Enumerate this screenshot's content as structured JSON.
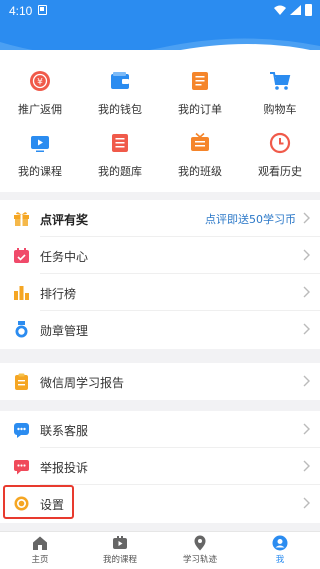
{
  "status_bar": {
    "time": "4:10"
  },
  "grid": [
    {
      "label": "推广返佣",
      "icon": "rebate-icon",
      "color": "#f05a4a"
    },
    {
      "label": "我的钱包",
      "icon": "wallet-icon",
      "color": "#2b8cf0"
    },
    {
      "label": "我的订单",
      "icon": "order-icon",
      "color": "#f5852a"
    },
    {
      "label": "购物车",
      "icon": "cart-icon",
      "color": "#2b8cf0"
    },
    {
      "label": "我的课程",
      "icon": "course-icon",
      "color": "#2b8cf0"
    },
    {
      "label": "我的题库",
      "icon": "question-bank-icon",
      "color": "#f05a4a"
    },
    {
      "label": "我的班级",
      "icon": "class-icon",
      "color": "#f5852a"
    },
    {
      "label": "观看历史",
      "icon": "history-icon",
      "color": "#f05a4a"
    }
  ],
  "menu": {
    "review": {
      "label": "点评有奖",
      "note": "点评即送50学习币"
    },
    "tasks": {
      "label": "任务中心"
    },
    "ranking": {
      "label": "排行榜"
    },
    "medals": {
      "label": "勋章管理"
    },
    "weekly_report": {
      "label": "微信周学习报告"
    },
    "support": {
      "label": "联系客服"
    },
    "report": {
      "label": "举报投诉"
    },
    "settings": {
      "label": "设置"
    }
  },
  "tabbar": [
    {
      "label": "主页",
      "icon": "home-icon",
      "active": false
    },
    {
      "label": "我的课程",
      "icon": "play-icon",
      "active": false
    },
    {
      "label": "学习轨迹",
      "icon": "location-pin-icon",
      "active": false
    },
    {
      "label": "我",
      "icon": "profile-icon",
      "active": true
    }
  ],
  "colors": {
    "primary": "#2b8cf0",
    "highlight_border": "#e83a2e",
    "note": "#2b78c8"
  }
}
